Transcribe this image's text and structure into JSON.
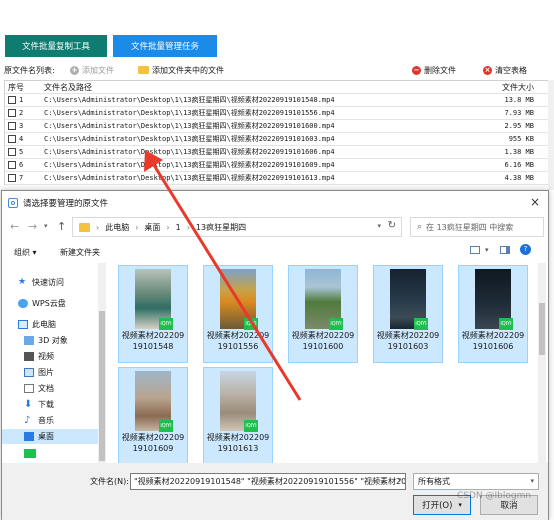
{
  "app": {
    "tabs": [
      "文件批量复制工具",
      "文件批量管理任务"
    ],
    "toolbar": {
      "label": "原文件名列表:",
      "add_file": "添加文件",
      "add_folder": "添加文件夹中的文件",
      "delete_file": "删除文件",
      "clear_table": "清空表格"
    },
    "table": {
      "headers": [
        "序号",
        "文件名及路径",
        "文件大小"
      ],
      "rows": [
        {
          "num": "1",
          "path": "C:\\Users\\Administrator\\Desktop\\1\\13疯狂星期四\\视频素材20220919101548.mp4",
          "size": "13.8 MB"
        },
        {
          "num": "2",
          "path": "C:\\Users\\Administrator\\Desktop\\1\\13疯狂星期四\\视频素材20220919101556.mp4",
          "size": "7.93 MB"
        },
        {
          "num": "3",
          "path": "C:\\Users\\Administrator\\Desktop\\1\\13疯狂星期四\\视频素材20220919101600.mp4",
          "size": "2.95 MB"
        },
        {
          "num": "4",
          "path": "C:\\Users\\Administrator\\Desktop\\1\\13疯狂星期四\\视频素材20220919101603.mp4",
          "size": "955 KB"
        },
        {
          "num": "5",
          "path": "C:\\Users\\Administrator\\Desktop\\1\\13疯狂星期四\\视频素材20220919101606.mp4",
          "size": "1.38 MB"
        },
        {
          "num": "6",
          "path": "C:\\Users\\Administrator\\Desktop\\1\\13疯狂星期四\\视频素材20220919101609.mp4",
          "size": "6.16 MB"
        },
        {
          "num": "7",
          "path": "C:\\Users\\Administrator\\Desktop\\1\\13疯狂星期四\\视频素材20220919101613.mp4",
          "size": "4.38 MB"
        }
      ]
    }
  },
  "dialog": {
    "title": "请选择要管理的原文件",
    "breadcrumb": [
      "此电脑",
      "桌面",
      "1",
      "13疯狂星期四"
    ],
    "search_placeholder": "在 13疯狂星期四 中搜索",
    "organize": "组织 ▾",
    "new_folder": "新建文件夹",
    "nav_items": [
      "快速访问",
      "WPS云盘",
      "此电脑",
      "3D 对象",
      "视频",
      "图片",
      "文档",
      "下载",
      "音乐",
      "桌面"
    ],
    "files": [
      {
        "name": "视频素材20220919101548"
      },
      {
        "name": "视频素材20220919101556"
      },
      {
        "name": "视频素材20220919101600"
      },
      {
        "name": "视频素材20220919101603"
      },
      {
        "name": "视频素材20220919101606"
      },
      {
        "name": "视频素材20220919101609"
      },
      {
        "name": "视频素材20220919101613"
      }
    ],
    "filename_label": "文件名(N):",
    "filename_value": "\"视频素材20220919101548\" \"视频素材20220919101556\" \"视频素材20",
    "filetype": "所有格式",
    "open": "打开(O)",
    "cancel": "取消",
    "watermark": "CSDN @Iblogmn"
  },
  "colors": {
    "tab1": "#0f7c72",
    "tab2": "#1a8be8",
    "selection": "#cce8ff",
    "arrow": "#e8392b"
  }
}
